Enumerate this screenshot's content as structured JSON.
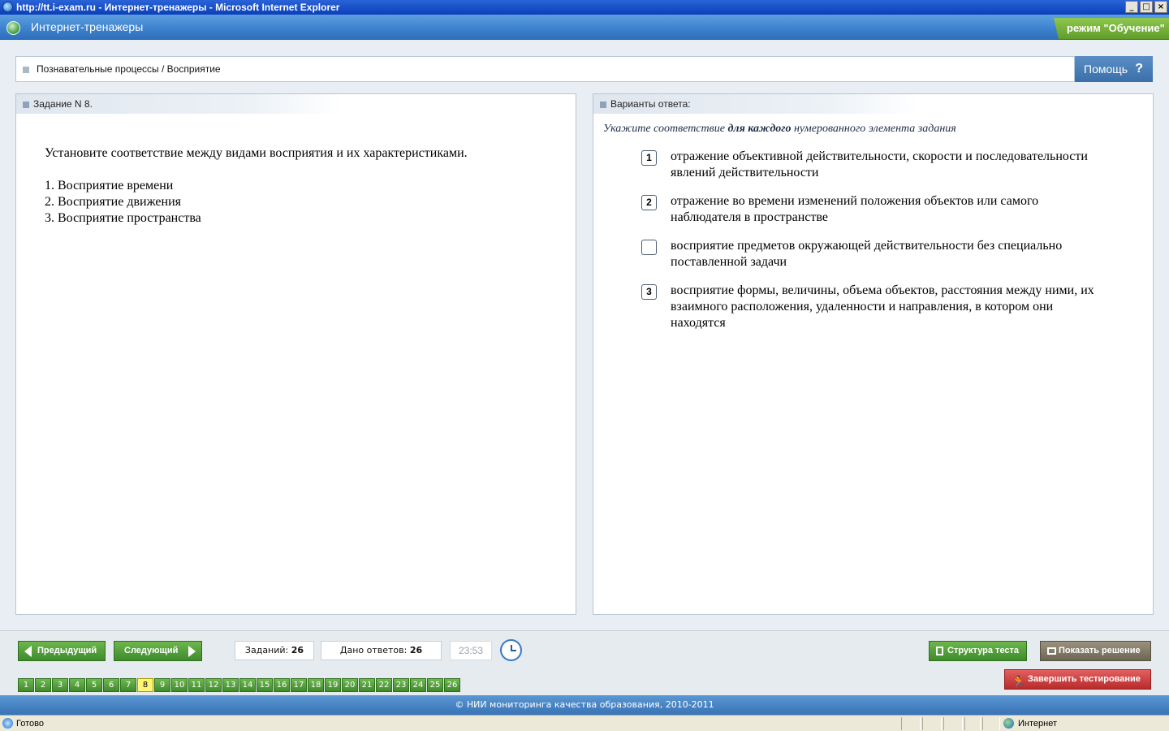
{
  "window": {
    "title": "http://tt.i-exam.ru - Интернет-тренажеры - Microsoft Internet Explorer",
    "buttons": [
      "_",
      "□",
      "×"
    ]
  },
  "header": {
    "app_name": "Интернет-тренажеры",
    "mode_label": "режим \"Обучение\""
  },
  "breadcrumb": "Познавательные процессы / Восприятие",
  "help": {
    "label": "Помощь",
    "icon": "?"
  },
  "task": {
    "header": "Задание N 8.",
    "question": "Установите соответствие между видами восприятия и их характеристиками.",
    "items": [
      "1. Восприятие времени",
      "2. Восприятие движения",
      "3. Восприятие пространства"
    ]
  },
  "answers": {
    "header": "Варианты ответа:",
    "instruction_prefix": "Укажите соответствие ",
    "instruction_bold": "для каждого",
    "instruction_suffix": " нумерованного элемента задания",
    "options": [
      {
        "mark": "1",
        "text": "отражение объективной действительности, скорости и последовательности явлений действительности"
      },
      {
        "mark": "2",
        "text": "отражение во времени изменений положения объектов или самого наблюдателя в пространстве"
      },
      {
        "mark": "",
        "text": "восприятие предметов окружающей действительности без специально поставленной задачи"
      },
      {
        "mark": "3",
        "text": "восприятие формы, величины, объема объектов, расстояния между ними, их взаимного расположения, удаленности и направления, в котором они находятся"
      }
    ]
  },
  "nav": {
    "prev": "Предыдущий",
    "next": "Следующий",
    "tasks_label": "Заданий:",
    "tasks_count": "26",
    "answers_label": "Дано ответов:",
    "answers_count": "26",
    "timer": "23:53",
    "structure": "Структура теста",
    "show_solution": "Показать решение",
    "finish": "Завершить тестирование",
    "pages": [
      "1",
      "2",
      "3",
      "4",
      "5",
      "6",
      "7",
      "8",
      "9",
      "10",
      "11",
      "12",
      "13",
      "14",
      "15",
      "16",
      "17",
      "18",
      "19",
      "20",
      "21",
      "22",
      "23",
      "24",
      "25",
      "26"
    ],
    "current_page": "8"
  },
  "footer": "© НИИ мониторинга качества образования, 2010-2011",
  "statusbar": {
    "text": "Готово",
    "zone": "Интернет"
  },
  "colors": {
    "accent": "#3e83cf",
    "button_green": "#4f9b35",
    "finish_red": "#c33a3a",
    "mode_green": "#7bb542",
    "current_page": "#fff676"
  }
}
